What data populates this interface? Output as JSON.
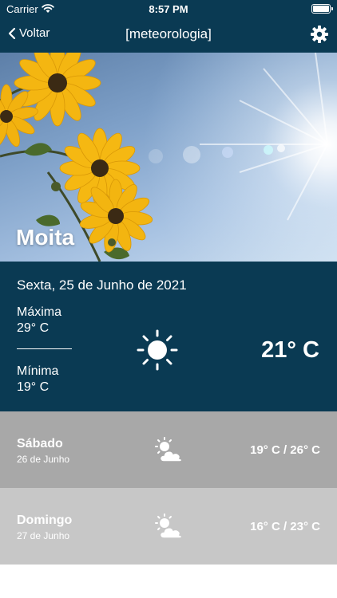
{
  "status_bar": {
    "carrier": "Carrier",
    "time": "8:57 PM",
    "wifi_icon": "wifi-icon",
    "battery_icon": "battery-icon"
  },
  "nav": {
    "back_label": "Voltar",
    "title": "[meteorologia]",
    "settings_icon": "gear-icon"
  },
  "hero": {
    "city": "Moita",
    "image": "sunflowers-and-sun-sky"
  },
  "today": {
    "date": "Sexta, 25 de Junho de 2021",
    "max_label": "Máxima",
    "max_value": "29° C",
    "min_label": "Mínima",
    "min_value": "19° C",
    "icon": "sun-icon",
    "temperature": "21° C"
  },
  "forecast": [
    {
      "day": "Sábado",
      "date": "26 de Junho",
      "icon": "partly-cloudy-icon",
      "range": "19° C / 26° C"
    },
    {
      "day": "Domingo",
      "date": "27 de Junho",
      "icon": "partly-cloudy-icon",
      "range": "16° C / 23° C"
    }
  ],
  "colors": {
    "primary": "#0a3a53",
    "forecast_1": "#a8a8a8",
    "forecast_2": "#c7c7c7"
  }
}
